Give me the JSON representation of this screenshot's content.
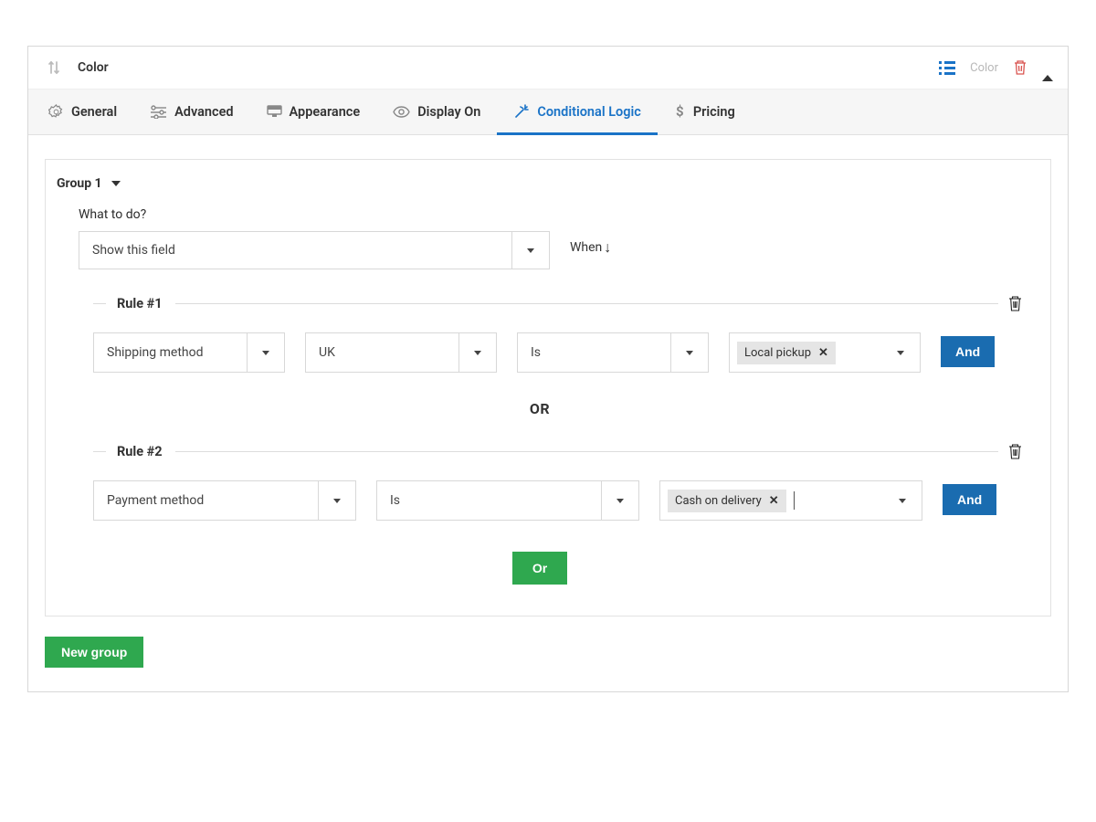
{
  "header": {
    "title": "Color",
    "right_label": "Color"
  },
  "tabs": [
    {
      "label": "General"
    },
    {
      "label": "Advanced"
    },
    {
      "label": "Appearance"
    },
    {
      "label": "Display On"
    },
    {
      "label": "Conditional Logic"
    },
    {
      "label": "Pricing"
    }
  ],
  "group": {
    "title": "Group 1",
    "what_label": "What to do?",
    "what_value": "Show this field",
    "when_label": "When",
    "rules": [
      {
        "title": "Rule #1",
        "field": "Shipping method",
        "param": "UK",
        "operator": "Is",
        "value_tag": "Local pickup",
        "connector": "And"
      },
      {
        "title": "Rule #2",
        "field": "Payment method",
        "operator": "Is",
        "value_tag": "Cash on delivery",
        "connector": "And"
      }
    ],
    "or_divider": "OR",
    "or_button": "Or"
  },
  "new_group_label": "New group"
}
